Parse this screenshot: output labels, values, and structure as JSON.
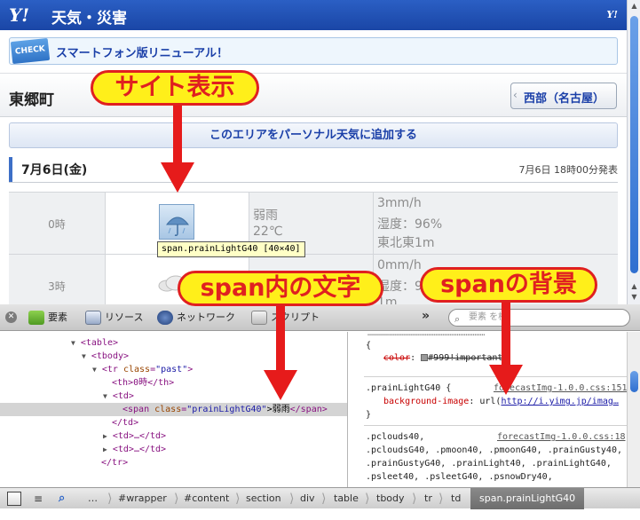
{
  "site": {
    "logo": "Y!",
    "title": "天気・災害",
    "small_logo": "Y!",
    "check_badge": "CHECK",
    "check_text": "スマートフォン版リニューアル！",
    "location": "東郷町",
    "region_button": "西部（名古屋）",
    "add_button": "このエリアをパーソナル天気に追加する",
    "date": "7月6日(金)",
    "announce": "7月6日 18時00分発表",
    "rows": [
      {
        "hour": "0時",
        "weather": "弱雨",
        "temp": "22℃",
        "rain": "3mm/h",
        "humidity": "湿度：96%",
        "wind": "東北東1m"
      },
      {
        "hour": "3時",
        "weather": "",
        "temp": "",
        "rain": "0mm/h",
        "humidity": "湿度：9",
        "wind": "1m"
      }
    ],
    "tooltip": "span.prainLightG40 [40×40]"
  },
  "callouts": {
    "site_display": "サイト表示",
    "span_text": "span内の文字",
    "span_bg": "spanの背景"
  },
  "inspector": {
    "tabs": [
      {
        "label": "要素",
        "icon": "elements-icon"
      },
      {
        "label": "リソース",
        "icon": "resources-icon"
      },
      {
        "label": "ネットワーク",
        "icon": "network-icon"
      },
      {
        "label": "スクリプト",
        "icon": "scripts-icon"
      }
    ],
    "more": "»",
    "search_placeholder": "要素 を検",
    "dom": {
      "l0": "<table>",
      "l1": "<tbody>",
      "l2_tag": "<tr ",
      "l2_attr": "class",
      "l2_val": "\"past\"",
      "l2_end": ">",
      "l3": "<th>0時</th>",
      "l4": "<td>",
      "l5_tag": "<span ",
      "l5_attr": "class",
      "l5_val": "\"prainLightG40\"",
      "l5_text": ">弱雨",
      "l5_end": "</span>",
      "l6": "</td>",
      "l7": "<td>…</td>",
      "l8": "<td>…</td>",
      "l9": "</tr>"
    },
    "styles": {
      "r0_brace": "{",
      "r0_prop": "color",
      "r0_val": "#999!important;",
      "r1_selector": ".prainLightG40 {",
      "r1_link": "forecastImg-1.0.0.css:151",
      "r1_prop": "background-image",
      "r1_val_a": ": url(",
      "r1_url": "http://i.yimg.jp/imag…",
      "r1_close": "}",
      "r2_line1": ".pclouds40,",
      "r2_link": "forecastImg-1.0.0.css:18",
      "r2_line2": ".pcloudsG40, .pmoon40, .pmoonG40, .prainGusty40,",
      "r2_line3": ".prainGustyG40, .prainLight40, .prainLightG40,",
      "r2_line4": ".psleet40, .psleetG40, .psnowDry40,"
    },
    "breadcrumb": [
      "…",
      "#wrapper",
      "#content",
      "section",
      "div",
      "table",
      "tbody",
      "tr",
      "td",
      "span.prainLightG40"
    ]
  },
  "colors": {
    "callout_fill": "#ffef1a",
    "callout_red": "#e02020",
    "yahoo_blue": "#1a46a6"
  }
}
